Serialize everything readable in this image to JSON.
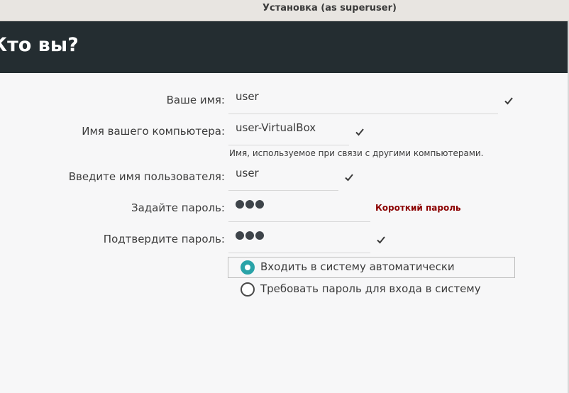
{
  "window": {
    "title": "Установка (as superuser)"
  },
  "page": {
    "heading": "Кто вы?"
  },
  "form": {
    "name": {
      "label": "Ваше имя:",
      "value": "user",
      "valid": true
    },
    "computer": {
      "label": "Имя вашего компьютера:",
      "value": "user-VirtualBox",
      "valid": true,
      "hint": "Имя, используемое при связи с другими компьютерами."
    },
    "username": {
      "label": "Введите имя пользователя:",
      "value": "user",
      "valid": true
    },
    "password": {
      "label": "Задайте пароль:",
      "masked_length": 3,
      "strength": "Короткий пароль"
    },
    "confirm": {
      "label": "Подтвердите пароль:",
      "masked_length": 3,
      "valid": true
    }
  },
  "login_options": [
    {
      "label": "Входить в систему автоматически",
      "selected": true
    },
    {
      "label": "Требовать пароль для входа в систему",
      "selected": false
    }
  ],
  "colors": {
    "header_bg": "#242d31",
    "accent": "#2aa3a8",
    "warning": "#8b0000"
  },
  "icons": {
    "valid": "check-icon"
  }
}
